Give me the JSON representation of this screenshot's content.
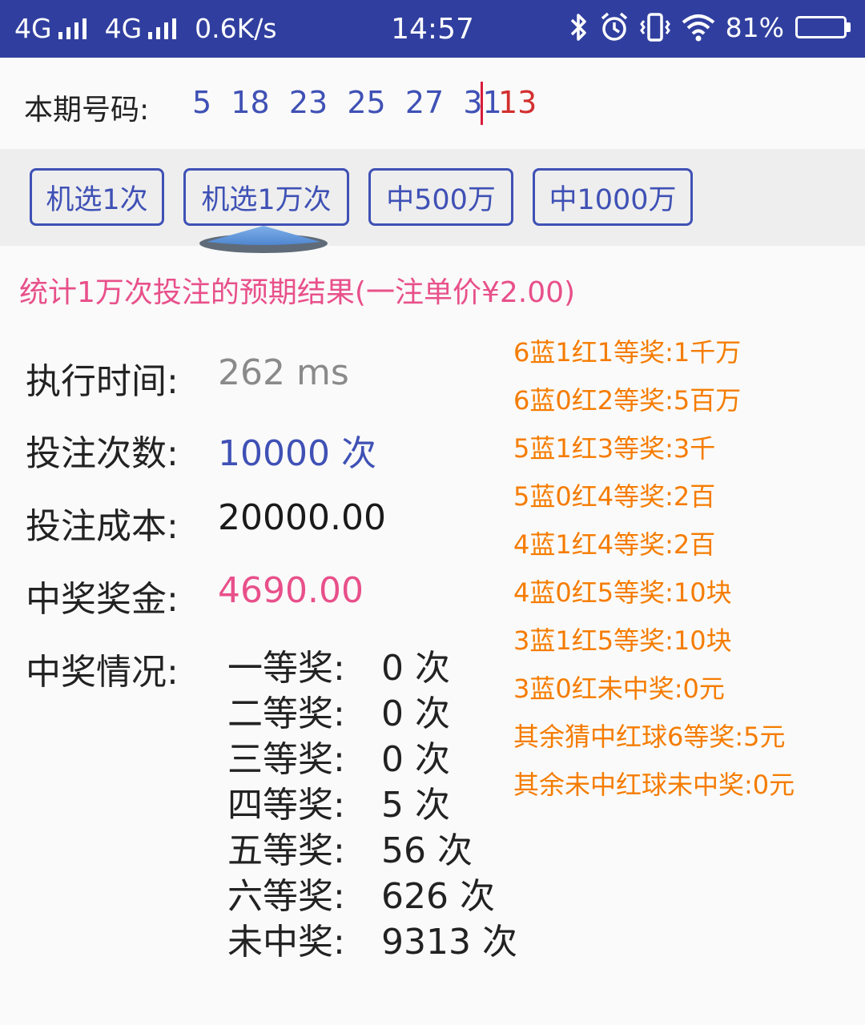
{
  "status_bar": {
    "net1": "4G",
    "net2": "4G",
    "speed": "0.6K/s",
    "time": "14:57",
    "battery_text": "81%",
    "battery_level": 0.81
  },
  "current_draw": {
    "label": "本期号码:",
    "red_balls": "5  18  23  25  27  31",
    "blue_ball": "13"
  },
  "buttons": [
    {
      "label": "机选1次"
    },
    {
      "label": "机选1万次"
    },
    {
      "label": "中500万"
    },
    {
      "label": "中1000万"
    }
  ],
  "summary_title": "统计1万次投注的预期结果(一注单价¥2.00)",
  "stats": {
    "exec_time_label": "执行时间:",
    "exec_time_value": "262 ms",
    "bet_count_label": "投注次数:",
    "bet_count_value": "10000 次",
    "cost_label": "投注成本:",
    "cost_value": "20000.00",
    "prize_label": "中奖奖金:",
    "prize_value": "4690.00",
    "result_label": "中奖情况:"
  },
  "tiers": [
    {
      "name": "一等奖:",
      "count": "0 次"
    },
    {
      "name": "二等奖:",
      "count": "0 次"
    },
    {
      "name": "三等奖:",
      "count": "0 次"
    },
    {
      "name": "四等奖:",
      "count": "5 次"
    },
    {
      "name": "五等奖:",
      "count": "56 次"
    },
    {
      "name": "六等奖:",
      "count": "626 次"
    },
    {
      "name": "未中奖:",
      "count": "9313 次"
    }
  ],
  "rules": [
    "6蓝1红1等奖:1千万",
    "6蓝0红2等奖:5百万",
    "5蓝1红3等奖:3千",
    "5蓝0红4等奖:2百",
    "4蓝1红4等奖:2百",
    "4蓝0红5等奖:10块",
    "3蓝1红5等奖:10块",
    "3蓝0红未中奖:0元",
    "其余猜中红球6等奖:5元",
    "其余未中红球未中奖:0元"
  ],
  "colors": {
    "primary": "#303f9f",
    "accent_blue": "#3f51b5",
    "pink": "#e8508a",
    "orange": "#f57c00",
    "red": "#d32f2f"
  }
}
